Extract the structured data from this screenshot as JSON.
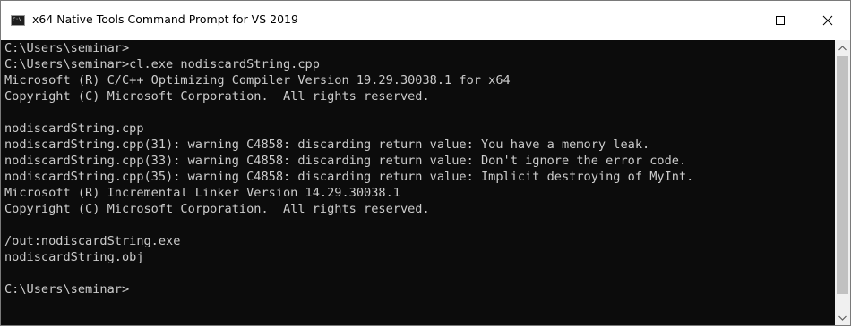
{
  "window": {
    "title": "x64 Native Tools Command Prompt for VS 2019",
    "icon_text": "C:\\",
    "buttons": {
      "minimize": "minimize-icon",
      "maximize": "maximize-icon",
      "close": "close-icon"
    }
  },
  "console": {
    "lines": [
      "C:\\Users\\seminar>",
      "C:\\Users\\seminar>cl.exe nodiscardString.cpp",
      "Microsoft (R) C/C++ Optimizing Compiler Version 19.29.30038.1 for x64",
      "Copyright (C) Microsoft Corporation.  All rights reserved.",
      "",
      "nodiscardString.cpp",
      "nodiscardString.cpp(31): warning C4858: discarding return value: You have a memory leak.",
      "nodiscardString.cpp(33): warning C4858: discarding return value: Don't ignore the error code.",
      "nodiscardString.cpp(35): warning C4858: discarding return value: Implicit destroying of MyInt.",
      "Microsoft (R) Incremental Linker Version 14.29.30038.1",
      "Copyright (C) Microsoft Corporation.  All rights reserved.",
      "",
      "/out:nodiscardString.exe",
      "nodiscardString.obj",
      "",
      "C:\\Users\\seminar>"
    ]
  },
  "colors": {
    "console_bg": "#0c0c0c",
    "console_fg": "#cccccc",
    "titlebar_bg": "#ffffff",
    "scrollbar_bg": "#f0f0f0",
    "scroll_thumb": "#c1c1c1"
  }
}
